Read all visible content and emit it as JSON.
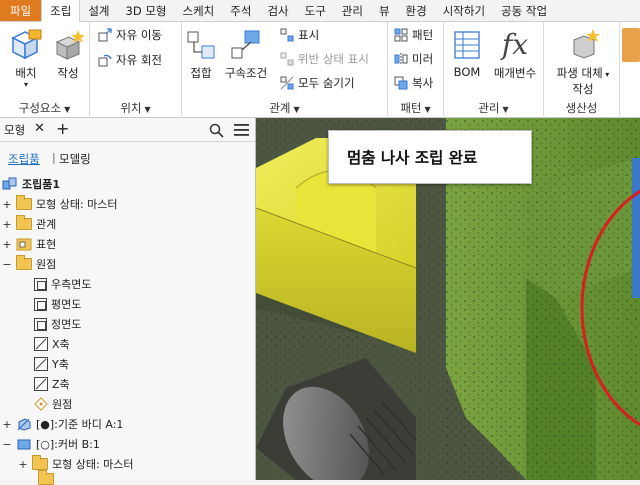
{
  "menubar": {
    "items": [
      "파일",
      "조립",
      "설계",
      "3D 모형",
      "스케치",
      "주석",
      "검사",
      "도구",
      "관리",
      "뷰",
      "환경",
      "시작하기",
      "공동 작업"
    ]
  },
  "ribbon": {
    "panels": {
      "component": {
        "title": "구성요소",
        "place_label": "배치",
        "create_label": "작성"
      },
      "position": {
        "title": "위치",
        "free_move_label": "자유 이동",
        "free_rotate_label": "자유 회전"
      },
      "relationships": {
        "title": "관계",
        "join_label": "접합",
        "constraint_label": "구속조건",
        "show_label": "표시",
        "show_sick_label": "위반 상태 표시",
        "hide_all_label": "모두 숨기기"
      },
      "pattern": {
        "title": "패턴",
        "pattern_label": "패턴",
        "mirror_label": "미러",
        "copy_label": "복사"
      },
      "manage": {
        "title": "관리",
        "bom_label": "BOM",
        "params_label": "매개변수"
      },
      "productivity": {
        "title": "생산성",
        "substitute_label_1": "파생 대체",
        "substitute_label_2": "작성"
      }
    }
  },
  "browser": {
    "tab_label": "모형",
    "view_assembly": "조립품",
    "view_modeling": "모델링",
    "tree": [
      {
        "label": "조립품1",
        "bold": true
      },
      {
        "label": "모형 상태: 마스터"
      },
      {
        "label": "관계"
      },
      {
        "label": "표현"
      },
      {
        "label": "원점"
      },
      {
        "label": "우측면도"
      },
      {
        "label": "평면도"
      },
      {
        "label": "정면도"
      },
      {
        "label": "X축"
      },
      {
        "label": "Y축"
      },
      {
        "label": "Z축"
      },
      {
        "label": "원점"
      },
      {
        "label": "[●]:기준 바디 A:1"
      },
      {
        "label": "[○]:커버 B:1"
      },
      {
        "label": "모형 상태: 마스터"
      }
    ]
  },
  "viewport": {
    "message": "멈춤 나사 조립 완료"
  },
  "colors": {
    "file_tab": "#e07a1f",
    "part_yellow": "#e9e43a",
    "part_green": "#6f9a3a",
    "highlight_circle": "#d81e1e"
  }
}
